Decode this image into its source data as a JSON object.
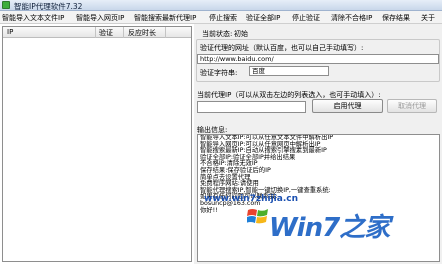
{
  "window": {
    "title": "智能IP代理软件7.32"
  },
  "menu": [
    "智能导入文本文件IP",
    "智能导入网页IP",
    "智能搜索最新代理IP",
    "停止搜索",
    "验证全部IP",
    "停止验证",
    "清除不合格IP",
    "保存结果",
    "关于"
  ],
  "proxy_list": {
    "columns": [
      "IP",
      "验证",
      "反应时长"
    ]
  },
  "status": {
    "label": "当前状态:",
    "value": "初始"
  },
  "verify": {
    "url_label": "验证代理的网址（默认百度，也可以自己手动填写）:",
    "url_value": "http://www.baidu.com/",
    "keyword_label": "验证字符串:",
    "keyword_value": "百度"
  },
  "current_proxy": {
    "label": "当前代理IP（可以从双击左边的列表选入，也可手动填入）:",
    "value": "",
    "enable_button": "启用代理",
    "cancel_button": "取消代理"
  },
  "output": {
    "label": "输出信息:",
    "lines": [
      "智能导入文本IP:可以从任意文本文件中解析出IP",
      "智能导入网页IP:可以从任意网页中解析出IP",
      "智能搜索最新IP:自动从搜索引擎搜素到最新IP",
      "验证全部IP:验证全部IP并给出结果",
      "不合格IP:清除无效IP",
      "保存结果:保存验证后的IP",
      "简单点去设置代理",
      "免费程序网站:请使用",
      "智能代理搜索IP,智能一键切换IP,一键查重系统:",
      "如果有任何问题可以联系我:",
      "bosuncp@163.com",
      "你好!!"
    ]
  },
  "watermark": {
    "text": "Win7之家",
    "url": "www.win7zhijia.cn"
  },
  "colors": {
    "watermark_blue": "#1d62c4",
    "titlebar": "#c8d7ea",
    "icon_green": "#3cae3c"
  }
}
